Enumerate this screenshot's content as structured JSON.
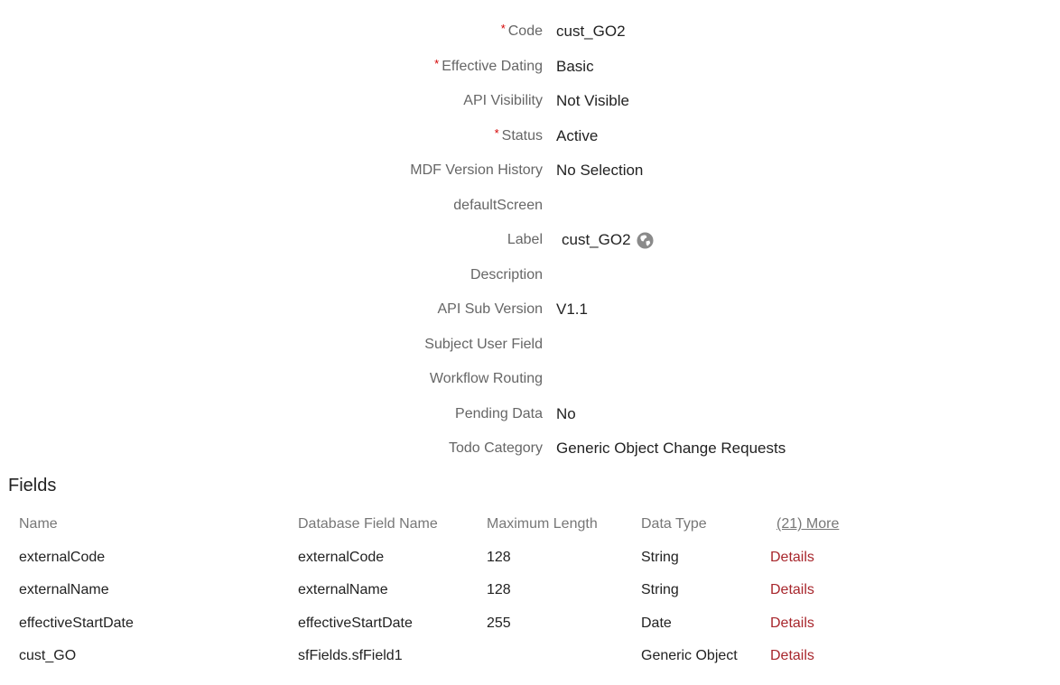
{
  "properties": [
    {
      "label": "Code",
      "required": true,
      "value": "cust_GO2"
    },
    {
      "label": "Effective Dating",
      "required": true,
      "value": "Basic"
    },
    {
      "label": "API Visibility",
      "required": false,
      "value": "Not Visible"
    },
    {
      "label": "Status",
      "required": true,
      "value": "Active"
    },
    {
      "label": "MDF Version History",
      "required": false,
      "value": "No Selection"
    },
    {
      "label": "defaultScreen",
      "required": false,
      "value": ""
    },
    {
      "label": "Label",
      "required": false,
      "value": "cust_GO2",
      "icon": "globe-icon"
    },
    {
      "label": "Description",
      "required": false,
      "value": ""
    },
    {
      "label": "API Sub Version",
      "required": false,
      "value": "V1.1"
    },
    {
      "label": "Subject User Field",
      "required": false,
      "value": ""
    },
    {
      "label": "Workflow Routing",
      "required": false,
      "value": ""
    },
    {
      "label": "Pending Data",
      "required": false,
      "value": "No"
    },
    {
      "label": "Todo Category",
      "required": false,
      "value": "Generic Object Change Requests"
    }
  ],
  "required_marker": "*",
  "fields": {
    "title": "Fields",
    "columns": [
      "Name",
      "Database Field Name",
      "Maximum Length",
      "Data Type"
    ],
    "more_link": "(21) More",
    "details_label": "Details",
    "rows": [
      {
        "name": "externalCode",
        "db_field": "externalCode",
        "max_length": "128",
        "data_type": "String"
      },
      {
        "name": "externalName",
        "db_field": "externalName",
        "max_length": "128",
        "data_type": "String"
      },
      {
        "name": "effectiveStartDate",
        "db_field": "effectiveStartDate",
        "max_length": "255",
        "data_type": "Date"
      },
      {
        "name": "cust_GO",
        "db_field": "sfFields.sfField1",
        "max_length": "",
        "data_type": "Generic Object"
      }
    ]
  },
  "colors": {
    "required": "#d40000",
    "link": "#a8272d",
    "label": "#666666",
    "text": "#222222"
  }
}
